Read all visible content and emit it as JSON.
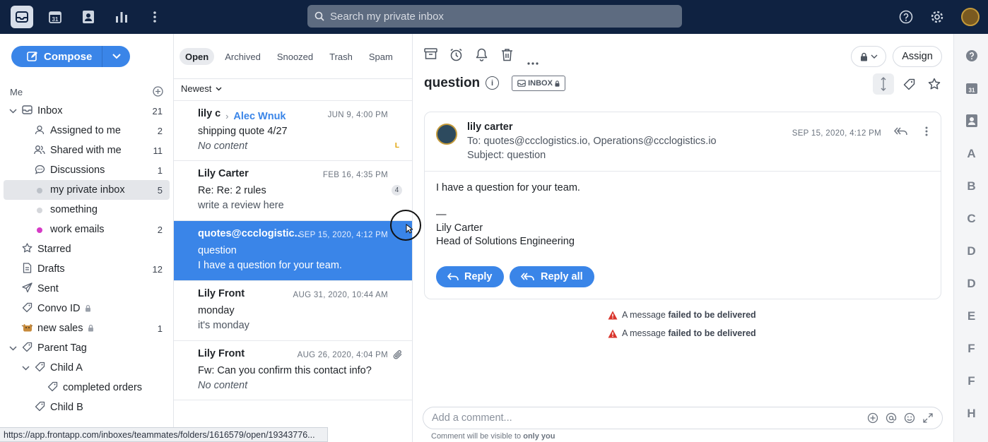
{
  "topbar": {
    "search_placeholder": "Search my private inbox",
    "icons": [
      "inbox-icon",
      "calendar-icon",
      "contacts-icon",
      "analytics-icon",
      "more-icon",
      "help-icon",
      "settings-icon"
    ],
    "calendar_day": "31"
  },
  "sidebar": {
    "compose_label": "Compose",
    "section_me": "Me",
    "items": [
      {
        "label": "Inbox",
        "count": "21"
      },
      {
        "label": "Assigned to me",
        "count": "2"
      },
      {
        "label": "Shared with me",
        "count": "11"
      },
      {
        "label": "Discussions",
        "count": "1"
      },
      {
        "label": "my private inbox",
        "count": "5"
      },
      {
        "label": "something",
        "count": ""
      },
      {
        "label": "work emails",
        "count": "2"
      },
      {
        "label": "Starred",
        "count": ""
      },
      {
        "label": "Drafts",
        "count": "12"
      },
      {
        "label": "Sent",
        "count": ""
      },
      {
        "label": "Convo ID",
        "count": ""
      },
      {
        "label": "new sales",
        "count": "1"
      },
      {
        "label": "Parent Tag",
        "count": ""
      },
      {
        "label": "Child A",
        "count": ""
      },
      {
        "label": "completed orders",
        "count": ""
      },
      {
        "label": "Child B",
        "count": ""
      }
    ],
    "colors": {
      "something_dot": "#d5d7db",
      "work_emails_dot": "#d63bc6",
      "my_private_inbox_dot": "#bcc1c8"
    }
  },
  "status_url": "https://app.frontapp.com/inboxes/teammates/folders/1616579/open/19343776...",
  "list": {
    "tabs": [
      "Open",
      "Archived",
      "Snoozed",
      "Trash",
      "Spam"
    ],
    "sort": "Newest",
    "conversations": [
      {
        "from": "lily c",
        "to": "Alec Wnuk",
        "date": "JUN 9, 4:00 PM",
        "subject": "shipping quote 4/27",
        "preview": "No content",
        "badge": "L"
      },
      {
        "from": "Lily Carter",
        "date": "FEB 16, 4:35 PM",
        "subject": "Re: Re: 2 rules",
        "preview": "write a review here",
        "badge": "4"
      },
      {
        "from": "quotes@ccclogistic...",
        "date": "SEP 15, 2020, 4:12 PM",
        "subject": "question",
        "preview": "I have a question for your team."
      },
      {
        "from": "Lily Front",
        "date": "AUG 31, 2020, 10:44 AM",
        "subject": "monday",
        "preview": "it's monday"
      },
      {
        "from": "Lily Front",
        "date": "AUG 26, 2020, 4:04 PM",
        "subject": "Fw: Can you confirm this contact info?",
        "preview": "No content"
      }
    ]
  },
  "reader": {
    "title": "question",
    "inbox_tag": "INBOX",
    "assign_label": "Assign",
    "message": {
      "from": "lily carter",
      "to": "To: quotes@ccclogistics.io, Operations@ccclogistics.io",
      "subject_label": "Subject: ",
      "subject": "question",
      "date": "SEP 15, 2020, 4:12 PM",
      "body_line1": "I have a question for your team.",
      "body_sig_dash": "—",
      "body_sig_name": "Lily Carter",
      "body_sig_title": "Head of Solutions Engineering",
      "reply_label": "Reply",
      "reply_all_label": "Reply all"
    },
    "warnings": [
      {
        "prefix": "A message ",
        "bold": "failed to be delivered"
      },
      {
        "prefix": "A message ",
        "bold": "failed to be delivered"
      }
    ],
    "comment_placeholder": "Add a comment...",
    "comment_note_prefix": "Comment will be visible to ",
    "comment_note_bold": "only you"
  },
  "rail": {
    "calendar_day": "31",
    "letters": [
      "A",
      "B",
      "C",
      "D",
      "D",
      "E",
      "F",
      "F",
      "H"
    ]
  }
}
